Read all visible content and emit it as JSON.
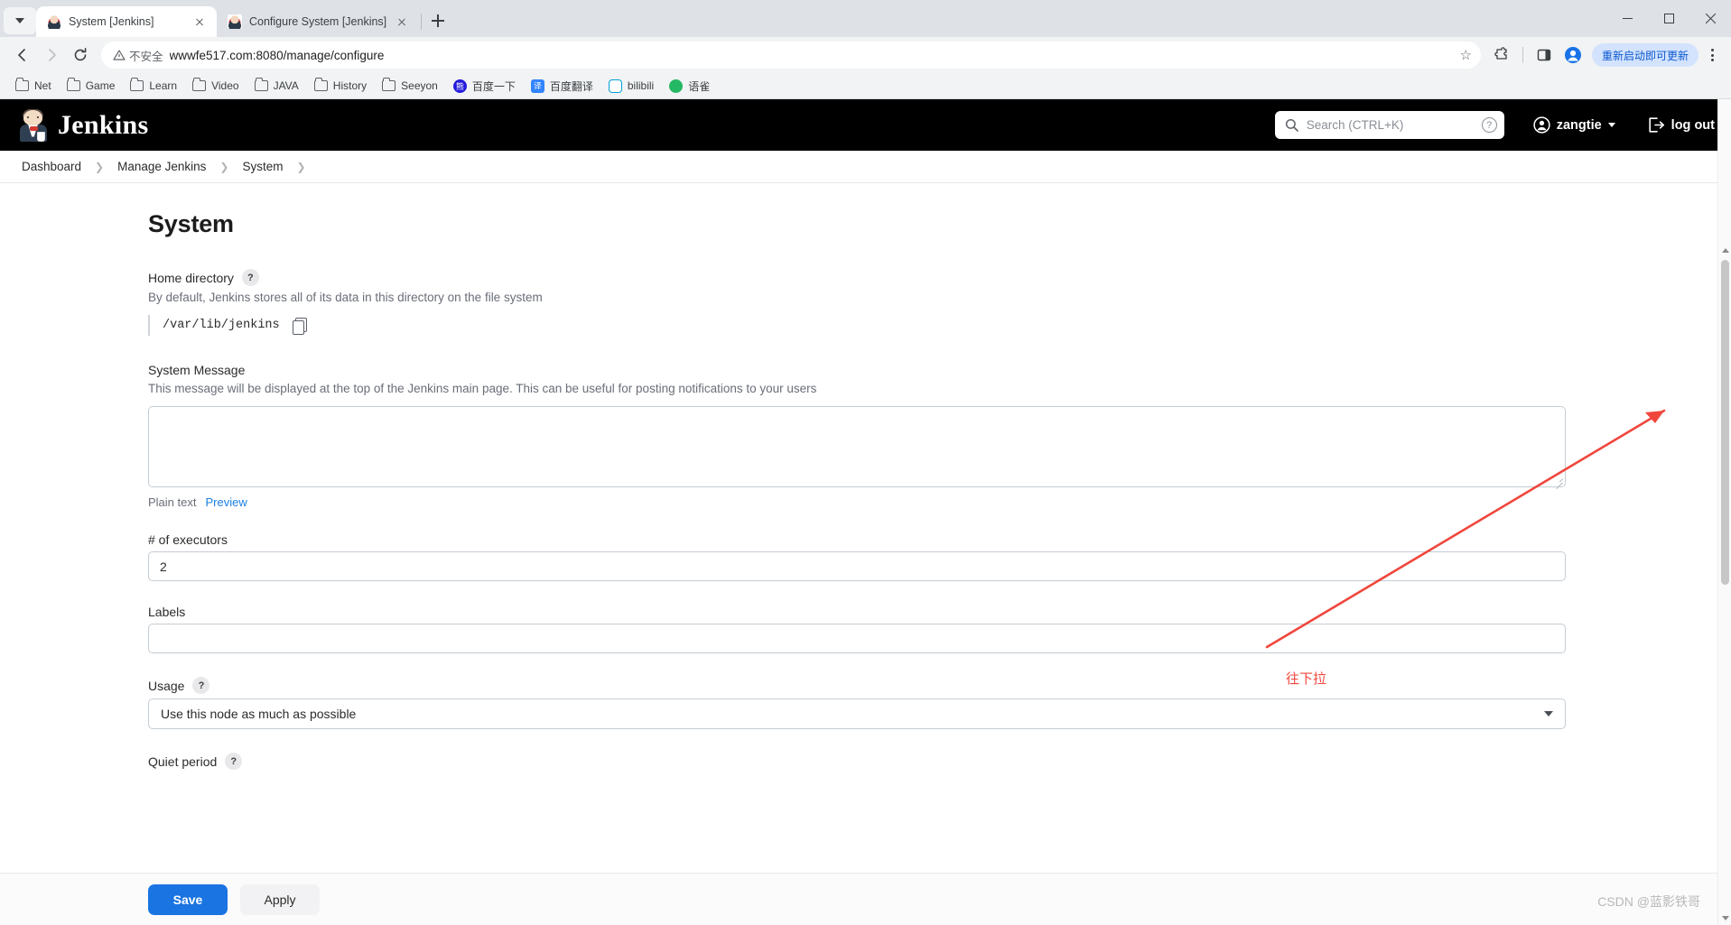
{
  "browser": {
    "tabs": [
      {
        "title": "System [Jenkins]",
        "active": true
      },
      {
        "title": "Configure System [Jenkins]",
        "active": false
      }
    ],
    "new_tab_label": "+",
    "omnibox": {
      "security_label": "不安全",
      "url": "wwwfe517.com:8080/manage/configure"
    },
    "update_button_label": "重新启动即可更新",
    "bookmarks": [
      {
        "label": "Net",
        "icon": "folder-icon"
      },
      {
        "label": "Game",
        "icon": "folder-icon"
      },
      {
        "label": "Learn",
        "icon": "folder-icon"
      },
      {
        "label": "Video",
        "icon": "folder-icon"
      },
      {
        "label": "JAVA",
        "icon": "folder-icon"
      },
      {
        "label": "History",
        "icon": "folder-icon"
      },
      {
        "label": "Seeyon",
        "icon": "folder-icon"
      },
      {
        "label": "百度一下",
        "icon": "baidu-icon"
      },
      {
        "label": "百度翻译",
        "icon": "fanyi-icon"
      },
      {
        "label": "bilibili",
        "icon": "bilibili-icon"
      },
      {
        "label": "语雀",
        "icon": "yuque-icon"
      }
    ]
  },
  "jenkins": {
    "brand": "Jenkins",
    "search": {
      "placeholder": "Search (CTRL+K)"
    },
    "help_badge": "?",
    "user": "zangtie",
    "logout": "log out",
    "breadcrumbs": [
      "Dashboard",
      "Manage Jenkins",
      "System"
    ],
    "page_title": "System"
  },
  "form": {
    "home_directory": {
      "label": "Home directory",
      "help": "?",
      "description": "By default, Jenkins stores all of its data in this directory on the file system",
      "value": "/var/lib/jenkins"
    },
    "system_message": {
      "label": "System Message",
      "description": "This message will be displayed at the top of the Jenkins main page. This can be useful for posting notifications to your users",
      "value": "",
      "format_label": "Plain text",
      "preview_link": "Preview"
    },
    "executors": {
      "label": "# of executors",
      "value": "2"
    },
    "labels": {
      "label": "Labels",
      "value": ""
    },
    "usage": {
      "label": "Usage",
      "help": "?",
      "selected": "Use this node as much as possible"
    },
    "quiet_period": {
      "label": "Quiet period",
      "help": "?"
    }
  },
  "actions": {
    "save_label": "Save",
    "apply_label": "Apply"
  },
  "annotation": {
    "text": "往下拉",
    "color": "#f0463c"
  },
  "watermark": "CSDN @蓝影铁哥",
  "colors": {
    "accent": "#1a74e2",
    "link": "#1b7fe3",
    "header_bg": "#000000",
    "annotation": "#f0463c"
  }
}
